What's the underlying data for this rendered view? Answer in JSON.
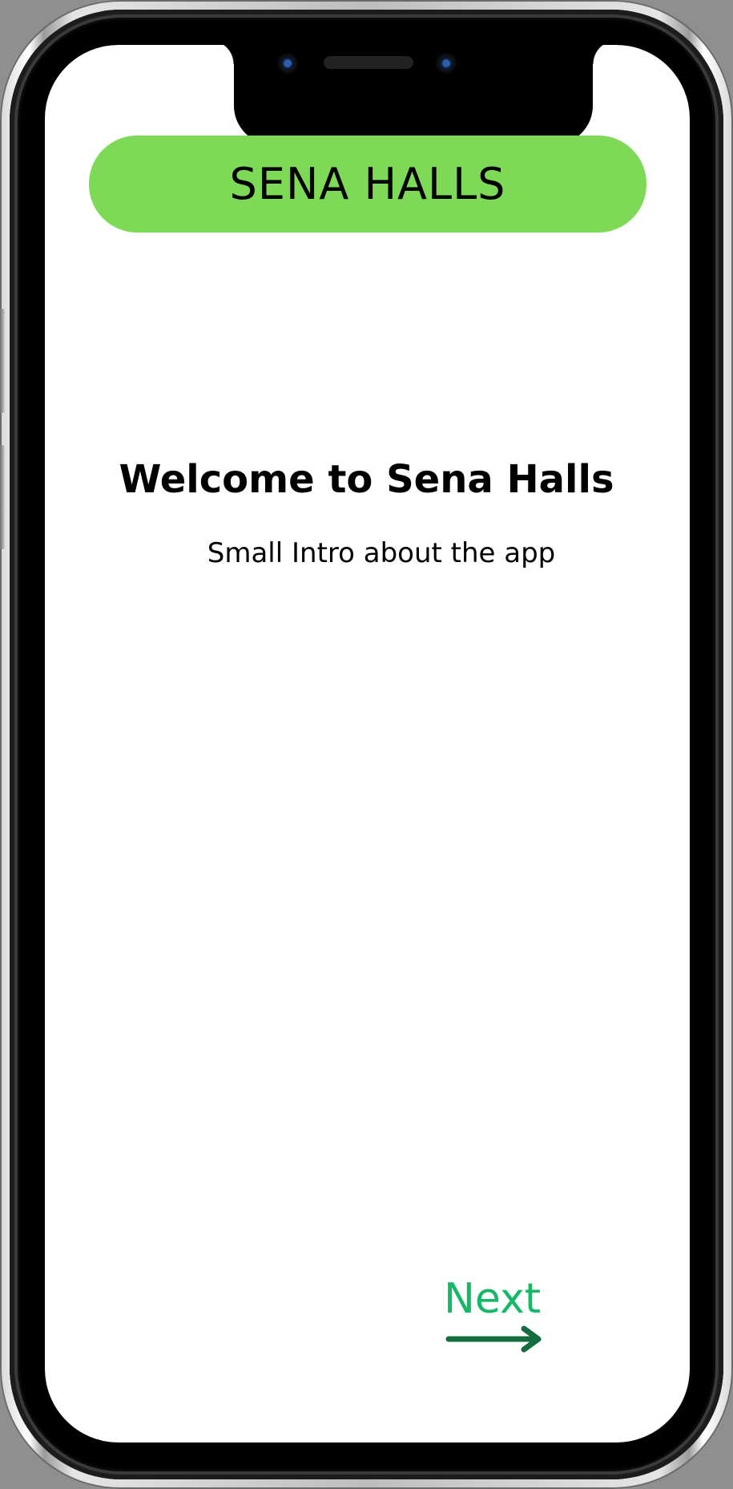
{
  "app": {
    "brand_title": "SENA HALLS"
  },
  "welcome": {
    "title": "Welcome to Sena Halls",
    "subtitle": "Small Intro about the app"
  },
  "navigation": {
    "next_label": "Next",
    "arrow_icon": "arrow-right-icon"
  },
  "colors": {
    "brand_green": "#7ed957",
    "next_text": "#14b866",
    "arrow": "#146c3f"
  }
}
